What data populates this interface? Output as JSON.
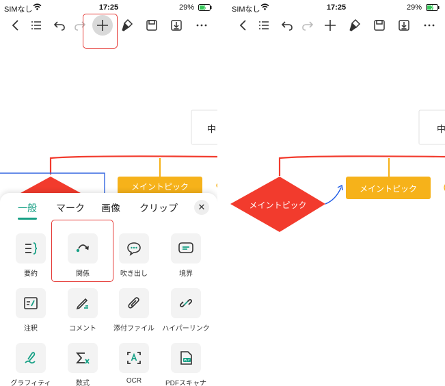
{
  "colors": {
    "accent": "#16a085",
    "node_red": "#f23b2d",
    "node_yellow": "#f6b21a",
    "highlight": "#e53935",
    "relation": "#1e5be6"
  },
  "left": {
    "status": {
      "carrier": "SIMなし",
      "time": "17:25",
      "battery": "29%"
    },
    "toolbar": {
      "icons": [
        "back-icon",
        "outline-icon",
        "undo-icon",
        "redo-icon",
        "plus-icon",
        "format-brush-icon",
        "save-icon",
        "download-icon",
        "more-icon"
      ]
    },
    "canvas": {
      "main_topic": "メイントピック",
      "partial_node": "中"
    },
    "panel": {
      "tabs": [
        "一般",
        "マーク",
        "画像",
        "クリップ"
      ],
      "tools": [
        {
          "label": "要約",
          "icon": "summary-icon"
        },
        {
          "label": "関係",
          "icon": "relationship-icon"
        },
        {
          "label": "吹き出し",
          "icon": "callout-icon"
        },
        {
          "label": "境界",
          "icon": "boundary-icon"
        },
        {
          "label": "注釈",
          "icon": "note-icon"
        },
        {
          "label": "コメント",
          "icon": "comment-icon"
        },
        {
          "label": "添付ファイル",
          "icon": "attachment-icon"
        },
        {
          "label": "ハイパーリンク",
          "icon": "hyperlink-icon"
        },
        {
          "label": "グラフィティ",
          "icon": "graffiti-icon"
        },
        {
          "label": "数式",
          "icon": "formula-icon"
        },
        {
          "label": "OCR",
          "icon": "ocr-icon"
        },
        {
          "label": "PDFスキャナ",
          "icon": "pdf-scanner-icon"
        }
      ]
    }
  },
  "right": {
    "status": {
      "carrier": "SIMなし",
      "time": "17:25",
      "battery": "29%"
    },
    "canvas": {
      "diamond_topic": "メイントピック",
      "main_topic": "メイントピック",
      "partial_node": "中"
    }
  }
}
